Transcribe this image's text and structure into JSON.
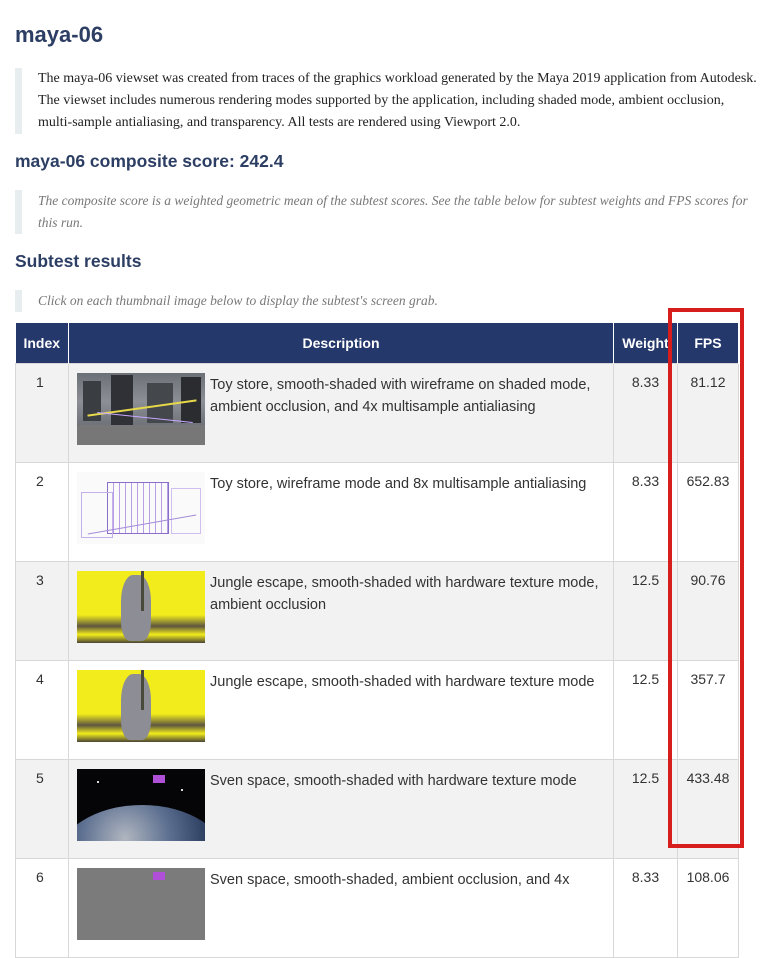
{
  "page": {
    "title": "maya-06",
    "intro": "The maya-06 viewset was created from traces of the graphics workload generated by the Maya 2019 application from Autodesk. The viewset includes numerous rendering modes supported by the application, including shaded mode, ambient occlusion, multi-sample antialiasing, and transparency. All tests are rendered using Viewport 2.0.",
    "composite_heading": "maya-06 composite score: 242.4",
    "composite_note": "The composite score is a weighted geometric mean of the subtest scores. See the table below for subtest weights and FPS scores for this run.",
    "subtest_heading": "Subtest results",
    "subtest_note": "Click on each thumbnail image below to display the subtest's screen grab."
  },
  "table": {
    "headers": {
      "index": "Index",
      "description": "Description",
      "weight": "Weight",
      "fps": "FPS"
    },
    "rows": [
      {
        "index": "1",
        "description": "Toy store, smooth-shaded with wireframe on shaded mode, ambient occlusion, and 4x multisample antialiasing",
        "weight": "8.33",
        "fps": "81.12",
        "thumbnail": "toy-store-shaded-wireframe"
      },
      {
        "index": "2",
        "description": "Toy store, wireframe mode and 8x multisample antialiasing",
        "weight": "8.33",
        "fps": "652.83",
        "thumbnail": "toy-store-wireframe"
      },
      {
        "index": "3",
        "description": "Jungle escape, smooth-shaded with hardware texture mode, ambient occlusion",
        "weight": "12.5",
        "fps": "90.76",
        "thumbnail": "jungle-escape-ao"
      },
      {
        "index": "4",
        "description": "Jungle escape, smooth-shaded with hardware texture mode",
        "weight": "12.5",
        "fps": "357.7",
        "thumbnail": "jungle-escape"
      },
      {
        "index": "5",
        "description": "Sven space, smooth-shaded with hardware texture mode",
        "weight": "12.5",
        "fps": "433.48",
        "thumbnail": "sven-space"
      },
      {
        "index": "6",
        "description": "Sven space, smooth-shaded, ambient occlusion, and 4x",
        "weight": "8.33",
        "fps": "108.06",
        "thumbnail": "sven-space-ao"
      }
    ]
  },
  "colors": {
    "heading": "#2c3e63",
    "table_header_bg": "#25386b",
    "highlight": "#d81d1d"
  }
}
